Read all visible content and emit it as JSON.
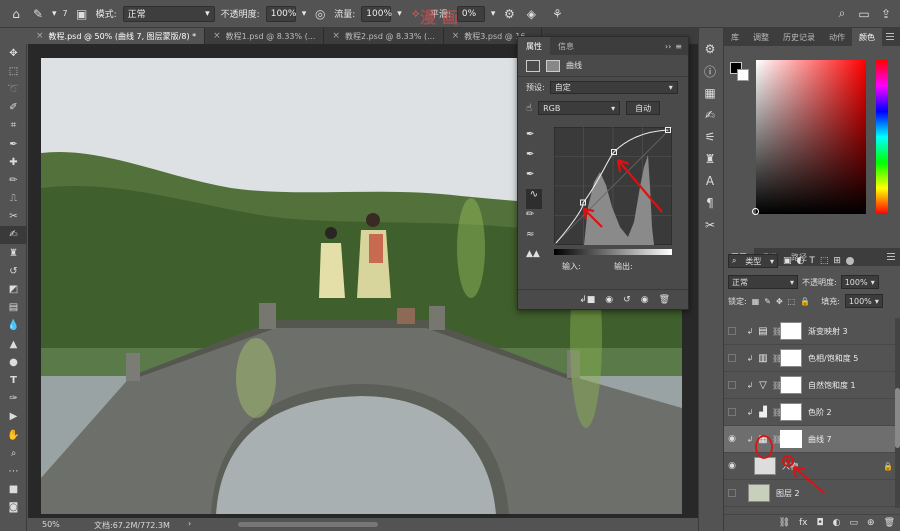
{
  "options_bar": {
    "brush_size": "7",
    "mode_label": "模式:",
    "mode_value": "正常",
    "opacity_label": "不透明度:",
    "opacity_value": "100%",
    "flow_label": "流量:",
    "flow_value": "100%",
    "smoothing_label": "平滑:",
    "smoothing_value": "0%"
  },
  "watermark": "漫画",
  "document_tabs": [
    {
      "label": "教程.psd @ 50% (曲线 7, 图层蒙版/8) *",
      "active": true
    },
    {
      "label": "教程1.psd @ 8.33% (...",
      "active": false
    },
    {
      "label": "教程2.psd @ 8.33% (...",
      "active": false
    },
    {
      "label": "教程3.psd @ 16...",
      "active": false
    }
  ],
  "status_bar": {
    "zoom": "50%",
    "doc_size": "文档:67.2M/772.3M"
  },
  "properties": {
    "tabs": [
      "属性",
      "信息"
    ],
    "title": "曲线",
    "preset_label": "预设:",
    "preset_value": "自定",
    "channel": "RGB",
    "auto_button": "自动",
    "input_label": "输入:",
    "output_label": "输出:"
  },
  "color_panel": {
    "tabs": [
      "库",
      "调整",
      "历史记录",
      "动作",
      "颜色"
    ],
    "active_tab": "颜色",
    "hue_color": "#ff0000"
  },
  "layers_panel": {
    "tabs": [
      "图层",
      "通道",
      "路径"
    ],
    "filter_label": "类型",
    "blend_mode": "正常",
    "opacity_label": "不透明度:",
    "opacity_value": "100%",
    "lock_label": "锁定:",
    "fill_label": "填充:",
    "fill_value": "100%",
    "layers": [
      {
        "name": "渐变映射 3",
        "icon": "gradient-map-icon",
        "visible": false,
        "selected": false
      },
      {
        "name": "色相/饱和度 5",
        "icon": "hue-saturation-icon",
        "visible": false,
        "selected": false
      },
      {
        "name": "自然饱和度 1",
        "icon": "vibrance-icon",
        "visible": false,
        "selected": false
      },
      {
        "name": "色阶 2",
        "icon": "levels-icon",
        "visible": false,
        "selected": false
      },
      {
        "name": "曲线 7",
        "icon": "curves-icon",
        "visible": true,
        "selected": true
      },
      {
        "name": "人物",
        "icon": "layer-thumb",
        "visible": true,
        "selected": false
      },
      {
        "name": "图层 2",
        "icon": "layer-thumb",
        "visible": false,
        "selected": false
      }
    ]
  },
  "colors": {
    "accent_arrow": "#e01010",
    "panel_bg": "#535353",
    "dark_bg": "#3d3d3d"
  }
}
